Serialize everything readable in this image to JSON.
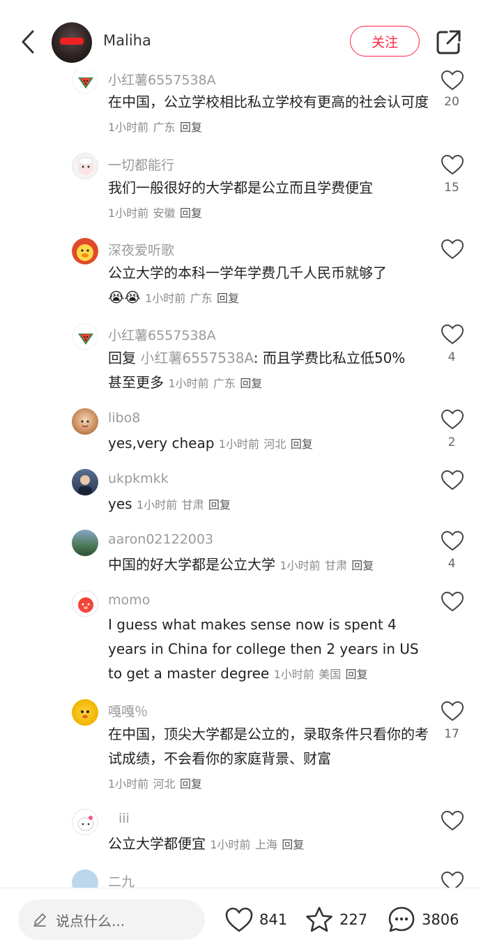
{
  "header": {
    "username": "Maliha",
    "follow_label": "关注"
  },
  "comments": [
    {
      "name": "小红薯6557538A",
      "text": "在中国，公立学校相比私立学校有更高的社会认可度",
      "time": "1小时前",
      "location": "广东",
      "reply": "回复",
      "likes": "20"
    },
    {
      "name": "一切都能行",
      "text": "我们一般很好的大学都是公立而且学费便宜",
      "time": "1小时前",
      "location": "安徽",
      "reply": "回复",
      "likes": "15"
    },
    {
      "name": "深夜爱听歌",
      "text": "公立大学的本科一学年学费几千人民币就够了",
      "emoji": "😭😭",
      "time": "1小时前",
      "location": "广东",
      "reply": "回复",
      "likes": ""
    },
    {
      "name": "小红薯6557538A",
      "reply_prefix": "回复",
      "mention": "小红薯6557538A",
      "text": ": 而且学费比私立低50%甚至更多",
      "time": "1小时前",
      "location": "广东",
      "reply": "回复",
      "likes": "4"
    },
    {
      "name": "libo8",
      "text": "yes,very cheap",
      "time": "1小时前",
      "location": "河北",
      "reply": "回复",
      "likes": "2"
    },
    {
      "name": "ukpkmkk",
      "text": "yes",
      "time": "1小时前",
      "location": "甘肃",
      "reply": "回复",
      "likes": ""
    },
    {
      "name": "aaron02122003",
      "text": "中国的好大学都是公立大学",
      "time": "1小时前",
      "location": "甘肃",
      "reply": "回复",
      "likes": "4"
    },
    {
      "name": "momo",
      "text": "I guess what makes sense now is spent 4 years in China for college then 2 years in US to get a master degree",
      "time": "1小时前",
      "location": "美国",
      "reply": "回复",
      "likes": ""
    },
    {
      "name": "嘎嘎％",
      "text": "在中国，顶尖大学都是公立的，录取条件只看你的考试成绩，不会看你的家庭背景、财富",
      "time": "1小时前",
      "location": "河北",
      "reply": "回复",
      "likes": "17"
    },
    {
      "name": "iii",
      "text": "公立大学都便宜",
      "time": "1小时前",
      "location": "上海",
      "reply": "回复",
      "likes": ""
    },
    {
      "name": "二九",
      "text": "",
      "time": "",
      "location": "",
      "reply": "",
      "likes": ""
    }
  ],
  "bottom_bar": {
    "input_placeholder": "说点什么...",
    "likes": "841",
    "stars": "227",
    "comments": "3806"
  },
  "icons": {
    "back": "chevron-left-icon",
    "share": "share-icon",
    "heart": "heart-icon",
    "star": "star-icon",
    "comment": "comment-bubble-icon",
    "pencil": "pencil-icon"
  },
  "colors": {
    "accent": "#ff2442",
    "name": "#9a9a9a",
    "meta": "#8a8a8a"
  }
}
